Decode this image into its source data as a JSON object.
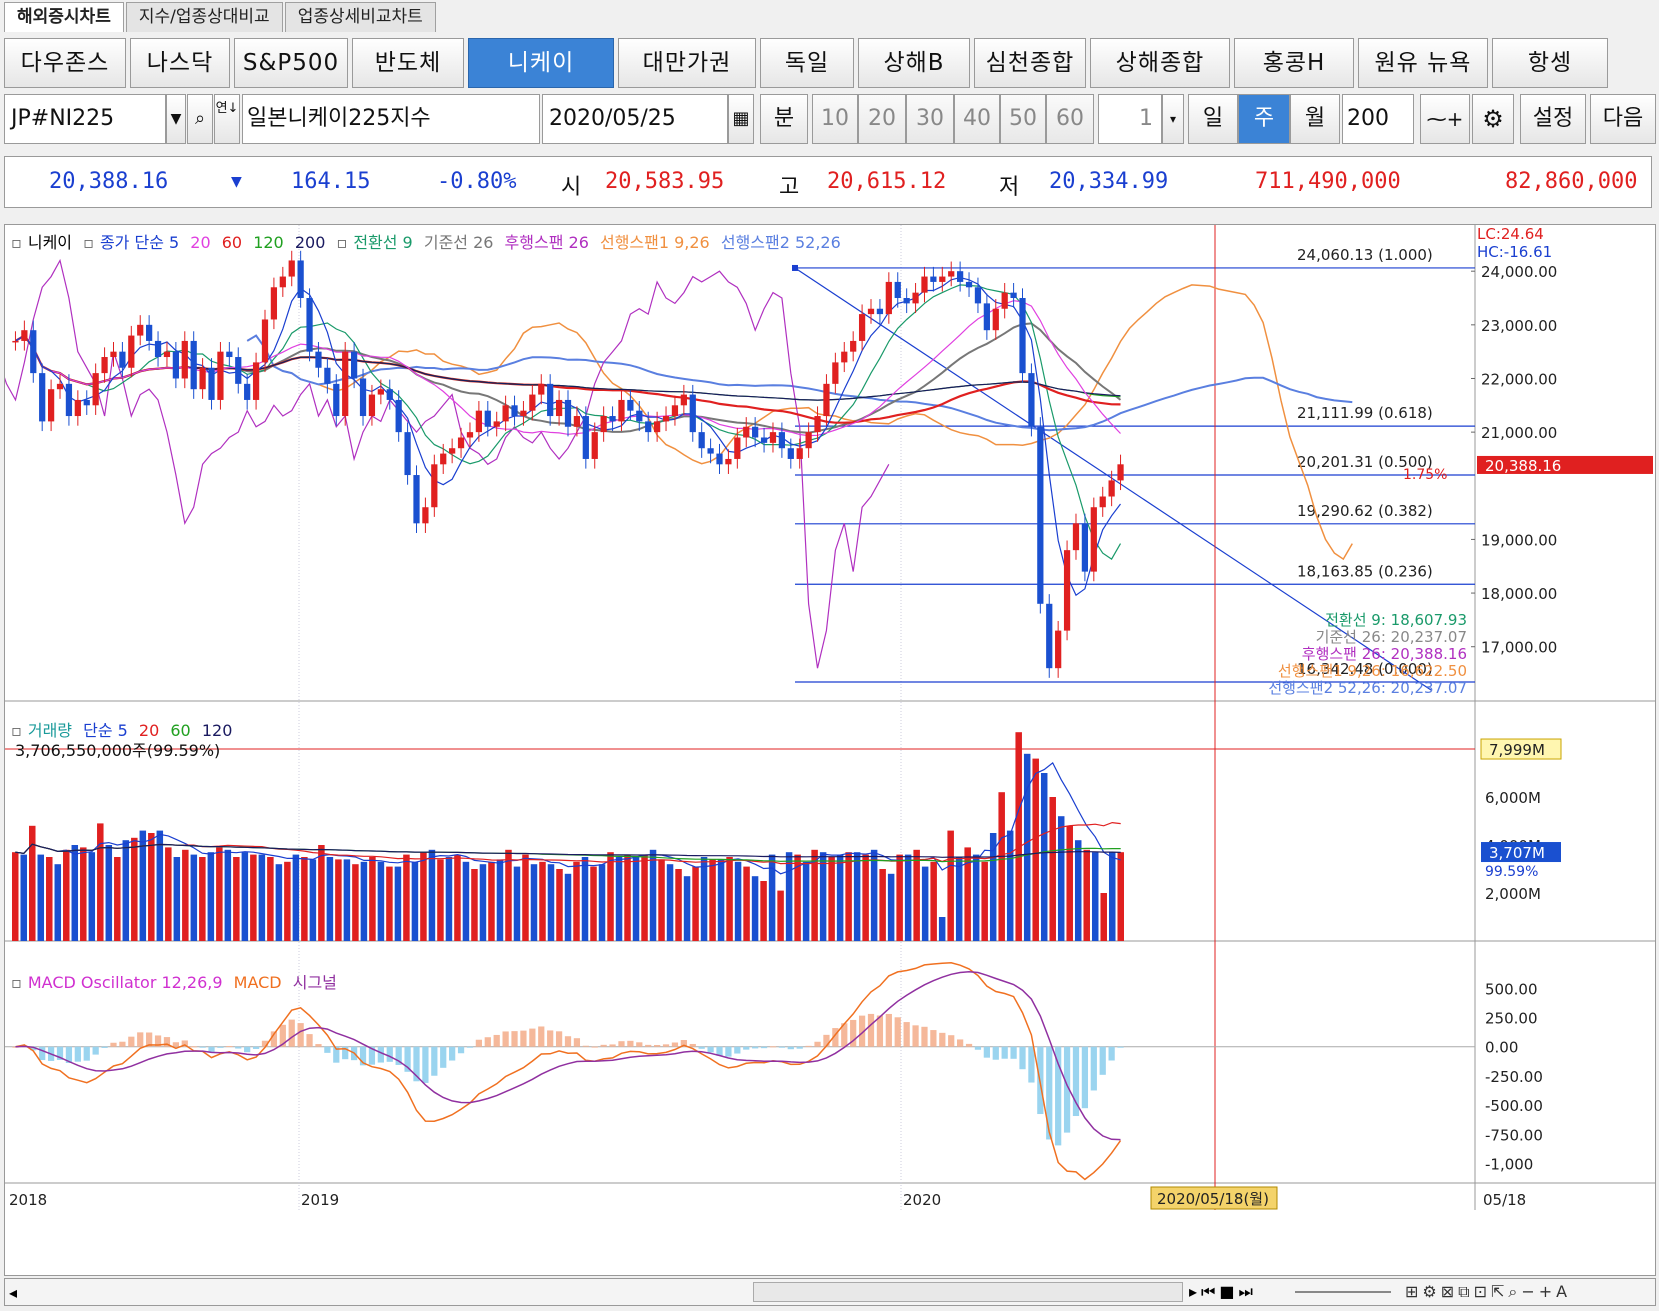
{
  "tabs": [
    "해외증시차트",
    "지수/업종상대비교",
    "업종상세비교차트"
  ],
  "index_buttons": [
    {
      "label": "다우존스",
      "active": false
    },
    {
      "label": "나스닥",
      "active": false
    },
    {
      "label": "S&P500",
      "active": false
    },
    {
      "label": "반도체",
      "active": false
    },
    {
      "label": "니케이",
      "active": true
    },
    {
      "label": "대만가권",
      "active": false
    },
    {
      "label": "독일",
      "active": false
    },
    {
      "label": "상해B",
      "active": false
    },
    {
      "label": "심천종합",
      "active": false
    },
    {
      "label": "상해종합",
      "active": false
    },
    {
      "label": "홍콩H",
      "active": false
    },
    {
      "label": "원유 뉴욕",
      "active": false
    },
    {
      "label": "항셍",
      "active": false
    }
  ],
  "controls": {
    "symbol": "JP#NI225",
    "symbol_name": "일본니케이225지수",
    "date": "2020/05/25",
    "minute_label": "분",
    "minute_options": [
      "10",
      "20",
      "30",
      "40",
      "50",
      "60"
    ],
    "spin_value": "1",
    "period_day": "일",
    "period_week": "주",
    "period_month": "월",
    "count": "200",
    "settings": "설정",
    "next": "다음"
  },
  "quote": {
    "last": "20,388.16",
    "change": "164.15",
    "change_pct": "-0.80%",
    "open_label": "시",
    "open": "20,583.95",
    "high_label": "고",
    "high": "20,615.12",
    "low_label": "저",
    "low": "20,334.99",
    "volume": "711,490,000",
    "amount": "82,860,000"
  },
  "price_legend": [
    "니케이",
    "종가 단순 5",
    "20",
    "60",
    "120",
    "200",
    "전환선 9",
    "기준선 26",
    "후행스팬 26",
    "선행스팬1 9,26",
    "선행스팬2 52,26"
  ],
  "price_axis": {
    "labels": [
      "24,000.00",
      "23,000.00",
      "22,000.00",
      "21,000.00",
      "19,000.00",
      "18,000.00",
      "17,000.00"
    ],
    "values": [
      24000,
      23000,
      22000,
      21000,
      19000,
      18000,
      17000
    ],
    "lc": "LC:24.64",
    "hc": "HC:-16.61",
    "current": "20,388.16",
    "current_pct": "1.75%"
  },
  "fibo": [
    {
      "label": "24,060.13 (1.000)",
      "value": 24060.13
    },
    {
      "label": "21,111.99 (0.618)",
      "value": 21111.99
    },
    {
      "label": "20,201.31 (0.500)",
      "value": 20201.31
    },
    {
      "label": "19,290.62 (0.382)",
      "value": 19290.62
    },
    {
      "label": "18,163.85 (0.236)",
      "value": 18163.85
    },
    {
      "label": "16,342.48 (0.000)",
      "value": 16342.48
    }
  ],
  "ichimoku_labels": [
    {
      "text": "전환선 9: 18,607.93",
      "color": "#1a9a6a"
    },
    {
      "text": "기준선 26: 20,237.07",
      "color": "#888888"
    },
    {
      "text": "후행스팬 26: 20,388.16",
      "color": "#b030c0"
    },
    {
      "text": "선행스팬1 9,26: 16,622.50",
      "color": "#f09040"
    },
    {
      "text": "선행스팬2 52,26: 20,237.07",
      "color": "#5a7fe0"
    }
  ],
  "volume_legend": [
    "거래량",
    "단순 5",
    "20",
    "60",
    "120"
  ],
  "volume_info": "3,706,550,000주(99.59%)",
  "volume_axis": {
    "labels": [
      "6,000M",
      "4,000M",
      "2,000M"
    ],
    "values": [
      6000,
      4000,
      2000
    ],
    "max_label": "7,999M",
    "current_label": "3,707M",
    "current_pct": "99.59%"
  },
  "macd_legend": [
    "MACD Oscillator 12,26,9",
    "MACD",
    "시그널"
  ],
  "macd_axis": {
    "labels": [
      "500.00",
      "250.00",
      "0.00",
      "-250.00",
      "-500.00",
      "-750.00",
      "-1,000"
    ],
    "values": [
      500,
      250,
      0,
      -250,
      -500,
      -750,
      -1000
    ]
  },
  "x_axis": {
    "labels": [
      "2018",
      "2019",
      "2020"
    ],
    "cursor_label": "2020/05/18(월)",
    "right_label": "05/18"
  },
  "chart_data": {
    "type": "candlestick",
    "title": "니케이",
    "weeks": 124,
    "ohlc_hint": "weekly candles 2018-01 to 2020-05",
    "closes": [
      22700,
      22900,
      22100,
      21200,
      21800,
      21900,
      21300,
      21600,
      21500,
      22100,
      22400,
      22500,
      22200,
      22800,
      23000,
      22700,
      22400,
      22500,
      22000,
      22700,
      21800,
      22200,
      21600,
      22500,
      22400,
      21900,
      21600,
      22300,
      23100,
      23700,
      23900,
      24200,
      23500,
      22500,
      22200,
      21900,
      21300,
      22500,
      22000,
      21300,
      21700,
      21800,
      21600,
      21000,
      20200,
      19300,
      19600,
      20400,
      20600,
      20700,
      20900,
      21000,
      21400,
      21100,
      21200,
      21500,
      21300,
      21400,
      21700,
      21900,
      21300,
      21600,
      21100,
      21300,
      20500,
      21000,
      21300,
      21200,
      21600,
      21400,
      21200,
      21000,
      21200,
      21300,
      21500,
      21700,
      21000,
      20700,
      20600,
      20400,
      20500,
      20900,
      21100,
      20900,
      20800,
      21000,
      20700,
      20500,
      20700,
      21000,
      21300,
      21900,
      22300,
      22500,
      22700,
      23200,
      23300,
      23200,
      23800,
      23500,
      23400,
      23600,
      23900,
      23800,
      23900,
      24000,
      23800,
      23700,
      23400,
      22900,
      23300,
      23600,
      23500,
      22100,
      21100,
      17800,
      16600,
      17300,
      18800,
      19300,
      18400,
      19600,
      19800,
      20100,
      20400
    ],
    "volumes": [
      3700,
      3600,
      4800,
      3600,
      3500,
      3200,
      3800,
      4000,
      3900,
      3700,
      4900,
      4000,
      3500,
      4200,
      4300,
      4600,
      4500,
      4600,
      3900,
      3500,
      3800,
      3600,
      3500,
      3700,
      3900,
      3800,
      3500,
      3700,
      3600,
      3600,
      3500,
      3200,
      3300,
      3600,
      3500,
      3400,
      4000,
      3500,
      3400,
      3400,
      3200,
      3300,
      3500,
      3300,
      3100,
      3100,
      3600,
      3300,
      3700,
      3800,
      3400,
      3500,
      3600,
      3300,
      3000,
      3200,
      3300,
      3400,
      3800,
      3100,
      3600,
      3200,
      3300,
      3200,
      3000,
      2800,
      3300,
      3500,
      3100,
      3200,
      3700,
      3500,
      3600,
      3500,
      3600,
      3800,
      3400,
      3200,
      3000,
      2700,
      3100,
      3500,
      3400,
      3400,
      3500,
      3300,
      3100,
      2700,
      2500,
      3600,
      2100,
      3700,
      3600,
      3300,
      3800,
      3700,
      3500,
      3600,
      3700,
      3700,
      3600,
      3800,
      3000,
      2800,
      3600,
      3600,
      3800,
      3100,
      3300,
      1000,
      4600,
      3500,
      3900,
      3600,
      3300,
      4500,
      6200,
      4600,
      8700,
      7800,
      7600,
      7000,
      6000,
      5200,
      4800,
      4200,
      3800,
      3700,
      2000,
      3700,
      3700
    ],
    "xlabels": [
      "2018",
      "2019",
      "2020"
    ]
  }
}
